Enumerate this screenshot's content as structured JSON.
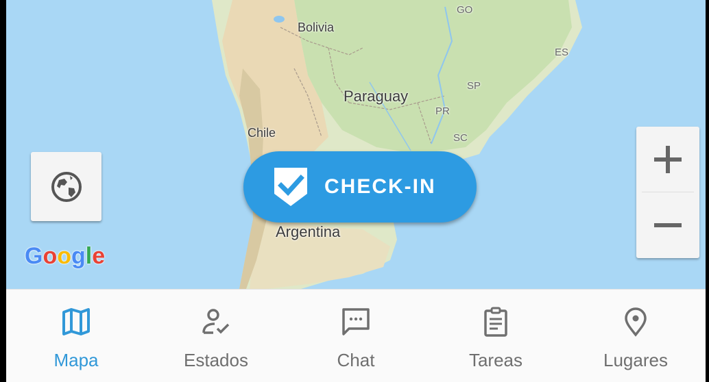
{
  "map": {
    "labels": {
      "bolivia": "Bolivia",
      "paraguay": "Paraguay",
      "chile": "Chile",
      "argentina": "Argentina",
      "go": "GO",
      "es": "ES",
      "sp": "SP",
      "pr": "PR",
      "sc": "SC"
    },
    "attribution": {
      "g": "G",
      "o1": "o",
      "o2": "o",
      "g2": "g",
      "l": "l",
      "e": "e"
    },
    "globe_icon": "globe-icon",
    "zoom_in_icon": "plus-icon",
    "zoom_out_icon": "minus-icon"
  },
  "checkin": {
    "label": "CHECK-IN",
    "icon": "shield-check-icon",
    "color": "#2d9be2"
  },
  "nav": {
    "active_color": "#3198d8",
    "inactive_color": "#6f6f6f",
    "items": [
      {
        "label": "Mapa",
        "icon": "map-icon",
        "active": true
      },
      {
        "label": "Estados",
        "icon": "person-check-icon",
        "active": false
      },
      {
        "label": "Chat",
        "icon": "chat-icon",
        "active": false
      },
      {
        "label": "Tareas",
        "icon": "clipboard-icon",
        "active": false
      },
      {
        "label": "Lugares",
        "icon": "location-pin-icon",
        "active": false
      }
    ]
  }
}
